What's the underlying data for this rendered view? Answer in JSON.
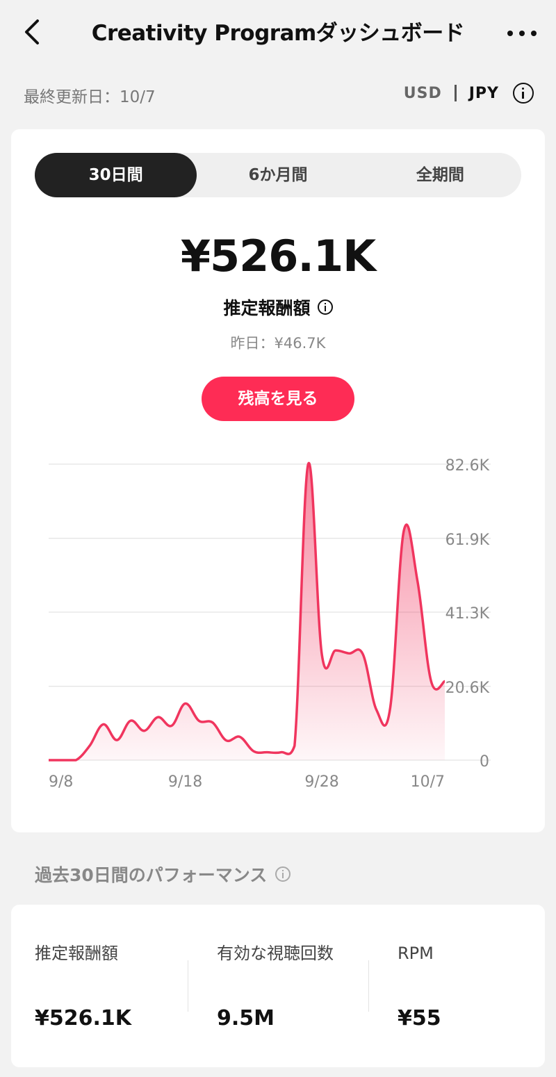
{
  "nav": {
    "title": "Creativity Programダッシュボード"
  },
  "subbar": {
    "updated": "最終更新日：10/7",
    "currency_usd": "USD",
    "currency_jpy": "JPY"
  },
  "tabs": [
    {
      "label": "30日間",
      "active": true
    },
    {
      "label": "6か月間",
      "active": false
    },
    {
      "label": "全期間",
      "active": false
    }
  ],
  "summary": {
    "amount": "¥526.1K",
    "amount_label": "推定報酬額",
    "yesterday": "昨日：¥46.7K",
    "balance_button": "残高を見る"
  },
  "colors": {
    "accent": "#fe2c55",
    "line": "#f0355e"
  },
  "chart_data": {
    "type": "area",
    "x": [
      "9/8",
      "9/9",
      "9/10",
      "9/11",
      "9/12",
      "9/13",
      "9/14",
      "9/15",
      "9/16",
      "9/17",
      "9/18",
      "9/19",
      "9/20",
      "9/21",
      "9/22",
      "9/23",
      "9/24",
      "9/25",
      "9/26",
      "9/27",
      "9/28",
      "9/29",
      "9/30",
      "10/1",
      "10/2",
      "10/3",
      "10/4",
      "10/5",
      "10/6",
      "10/7"
    ],
    "values": [
      0,
      0,
      0,
      4000,
      10000,
      5600,
      11000,
      8200,
      12000,
      9600,
      15800,
      11000,
      10500,
      5500,
      6500,
      2500,
      2200,
      2200,
      4000,
      82600,
      29500,
      30600,
      29800,
      29600,
      14000,
      14500,
      64000,
      50000,
      22000,
      22000
    ],
    "x_ticks": [
      "9/8",
      "9/18",
      "9/28",
      "10/7"
    ],
    "y_ticks": [
      "82.6K",
      "61.9K",
      "41.3K",
      "20.6K",
      "0"
    ],
    "y_tick_values": [
      82600,
      61900,
      41300,
      20600,
      0
    ],
    "ylim": [
      0,
      82600
    ],
    "grid": true,
    "xlabel": "",
    "ylabel": ""
  },
  "performance": {
    "title": "過去30日間のパフォーマンス",
    "metrics": [
      {
        "label": "推定報酬額",
        "value": "¥526.1K"
      },
      {
        "label": "有効な視聴回数",
        "value": "9.5M"
      },
      {
        "label": "RPM",
        "value": "¥55"
      }
    ]
  }
}
